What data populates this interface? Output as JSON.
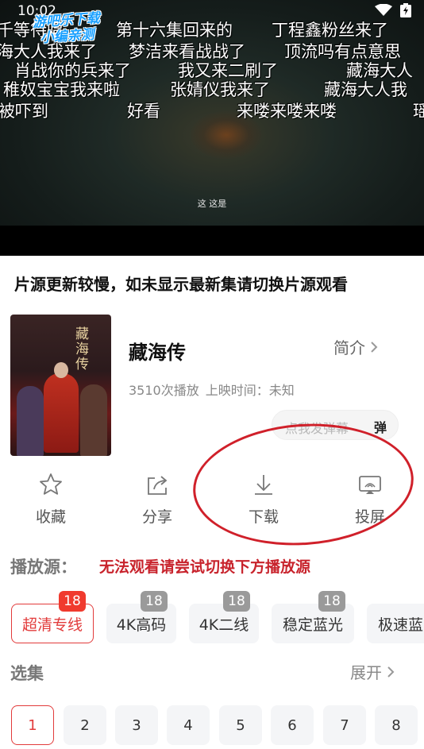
{
  "status_bar": {
    "time": "10:02"
  },
  "watermark": {
    "line1": "游吧乐下载",
    "line2": "小编亲测"
  },
  "player": {
    "subtitle": "这 这是",
    "danmaku": [
      "千等待唱",
      "第十六集回来的",
      "丁程鑫粉丝来了",
      "海大人我来了",
      "梦洁来看战战了",
      "顶流吗有点意思",
      "肖战你的兵来了",
      "我又来二刷了",
      "藏海大人",
      "稚奴宝宝我来啦",
      "张婧仪我来了",
      "藏海大人我",
      "被吓到",
      "好看",
      "来喽来喽来喽",
      "瑶"
    ]
  },
  "notice": "片源更新较慢，如未显示最新集请切换片源观看",
  "detail": {
    "poster_title": "藏海传",
    "title": "藏海传",
    "intro_label": "简介",
    "play_count": "3510次播放",
    "release": "上映时间：未知",
    "danmaku_placeholder": "点我发弹幕",
    "danmaku_send": "弹"
  },
  "actions": [
    {
      "label": "收藏",
      "icon": "star-icon"
    },
    {
      "label": "分享",
      "icon": "share-icon"
    },
    {
      "label": "下载",
      "icon": "download-icon"
    },
    {
      "label": "投屏",
      "icon": "cast-icon"
    }
  ],
  "source": {
    "label": "播放源：",
    "hint": "无法观看请尝试切换下方播放源",
    "items": [
      {
        "name": "超清专线",
        "count": "18",
        "active": true
      },
      {
        "name": "4K高码",
        "count": "18",
        "active": false
      },
      {
        "name": "4K二线",
        "count": "18",
        "active": false
      },
      {
        "name": "稳定蓝光",
        "count": "18",
        "active": false
      },
      {
        "name": "极速蓝",
        "count": "",
        "active": false
      }
    ]
  },
  "episodes": {
    "label": "选集",
    "expand_label": "展开",
    "items": [
      "1",
      "2",
      "3",
      "4",
      "5",
      "6",
      "7",
      "8"
    ],
    "active": "1"
  },
  "colors": {
    "accent": "#e23b3b",
    "hint_red": "#c8232c",
    "badge_gray": "#9a9a9a",
    "badge_red": "#f03a2e",
    "annotation_circle": "#d0202a"
  }
}
